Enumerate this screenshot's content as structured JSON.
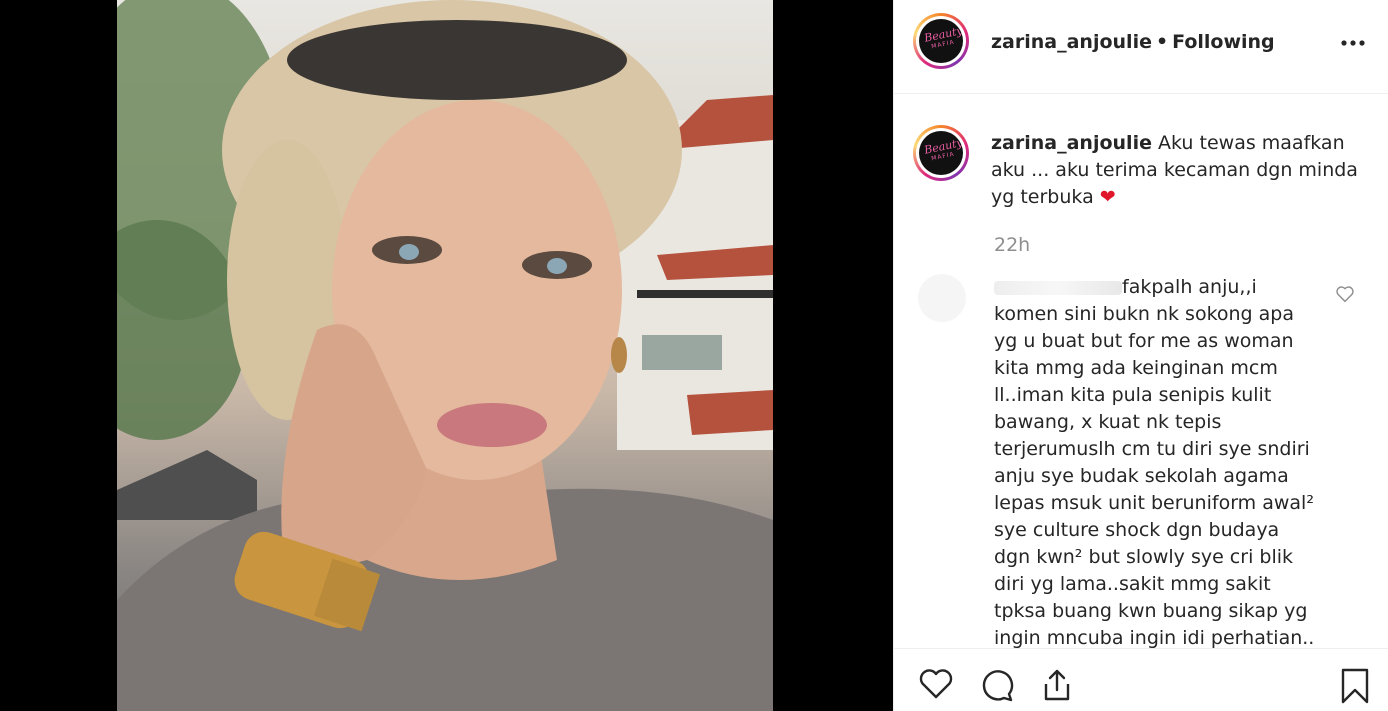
{
  "post": {
    "username": "zarina_anjoulie",
    "separator": "•",
    "follow_status": "Following",
    "more_label": "•••",
    "avatar_logo_line1": "Beauty",
    "avatar_logo_line2": "MAFIA",
    "caption_username": "zarina_anjoulie",
    "caption_text": "Aku tewas maafkan aku ... aku terima kecaman dgn minda yg terbuka",
    "caption_emoji": "❤",
    "time_ago": "22h"
  },
  "comment": {
    "text_lines": [
      "fakpalh anju,,i",
      "komen sini bukn nk sokong apa",
      "yg u buat but for me as woman",
      "kita mmg ada keinginan mcm",
      "ll..iman kita pula senipis kulit",
      "bawang, x kuat nk tepis",
      "terjerumuslh cm tu diri sye sndiri",
      "anju sye budak sekolah agama",
      "lepas msuk unit beruniform awal²",
      "sye culture shock dgn budaya",
      "dgn kwn² but slowly sye cri blik",
      "diri yg lama..sakit mmg sakit",
      "tpksa buang kwn buang sikap yg",
      "ingin mncuba ingin idi perhatian.."
    ]
  },
  "icons": {
    "like": "heart-outline-icon",
    "comment": "speech-bubble-icon",
    "share": "share-upload-icon",
    "save": "bookmark-icon",
    "comment_like": "small-heart-icon"
  }
}
